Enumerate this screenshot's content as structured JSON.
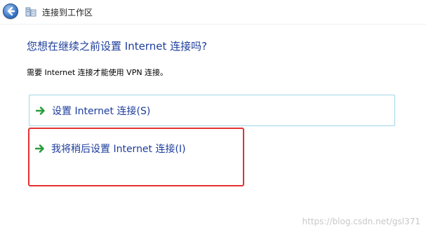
{
  "window": {
    "title": "连接到工作区"
  },
  "main": {
    "heading": "您想在继续之前设置 Internet 连接吗?",
    "description": "需要 Internet 连接才能使用 VPN 连接。",
    "options": [
      {
        "label": "设置 Internet 连接(S)",
        "icon": "green-arrow-icon"
      },
      {
        "label": "我将稍后设置 Internet 连接(I)",
        "icon": "green-arrow-icon"
      }
    ]
  },
  "watermark": "https://blog.csdn.net/gsl371",
  "colors": {
    "heading": "#1d3d9b",
    "annotation_border": "#e53030",
    "option_border": "#9fd6e6",
    "arrow": "#2a9d3c"
  }
}
